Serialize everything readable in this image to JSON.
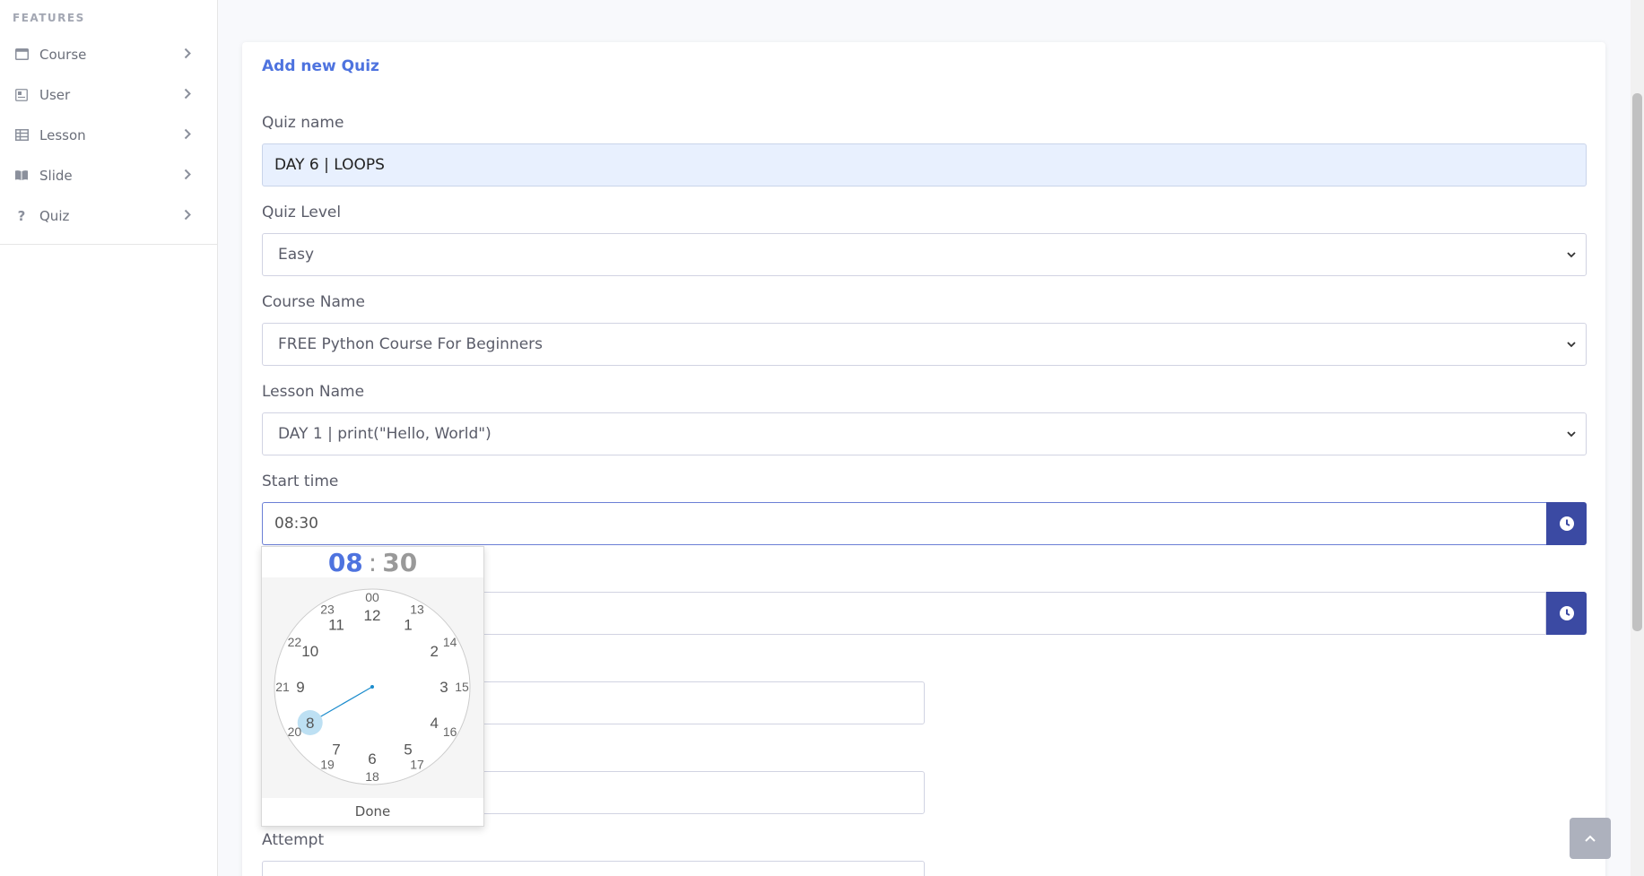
{
  "sidebar": {
    "heading": "FEATURES",
    "items": [
      {
        "label": "Course",
        "icon": "window-icon"
      },
      {
        "label": "User",
        "icon": "id-card-icon"
      },
      {
        "label": "Lesson",
        "icon": "table-icon"
      },
      {
        "label": "Slide",
        "icon": "book-icon"
      },
      {
        "label": "Quiz",
        "icon": "question-icon"
      }
    ]
  },
  "card": {
    "title": "Add new Quiz"
  },
  "form": {
    "quiz_name_label": "Quiz name",
    "quiz_name_value": "DAY 6 | LOOPS",
    "quiz_level_label": "Quiz Level",
    "quiz_level_value": "Easy",
    "course_name_label": "Course Name",
    "course_name_value": "FREE Python Course For Beginners",
    "lesson_name_label": "Lesson Name",
    "lesson_name_value": "DAY 1 | print(\"Hello, World\")",
    "start_time_label": "Start time",
    "start_time_value": "08:30",
    "attempt_label": "Attempt"
  },
  "clockpicker": {
    "hours": "08",
    "separator": ":",
    "minutes": "30",
    "done_label": "Done",
    "selected_hour": "8",
    "outer_hours": [
      "12",
      "1",
      "2",
      "3",
      "4",
      "5",
      "6",
      "7",
      "8",
      "9",
      "10",
      "11"
    ],
    "inner_hours": [
      "00",
      "13",
      "14",
      "15",
      "16",
      "17",
      "18",
      "19",
      "20",
      "21",
      "22",
      "23"
    ]
  },
  "colors": {
    "accent": "#4e73df",
    "button": "#3b4aa3",
    "filled_input": "#e8f0fe"
  }
}
